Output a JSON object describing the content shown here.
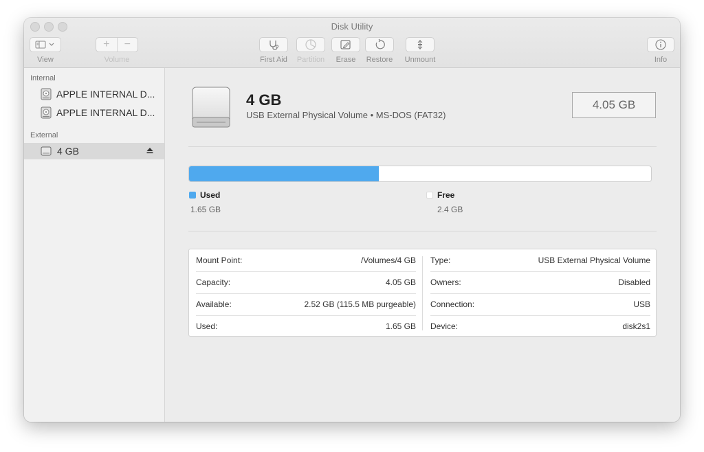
{
  "window": {
    "title": "Disk Utility"
  },
  "toolbar": {
    "view_label": "View",
    "volume_label": "Volume",
    "first_aid_label": "First Aid",
    "partition_label": "Partition",
    "erase_label": "Erase",
    "restore_label": "Restore",
    "unmount_label": "Unmount",
    "info_label": "Info"
  },
  "sidebar": {
    "internal_header": "Internal",
    "external_header": "External",
    "internal_items": [
      {
        "label": "APPLE INTERNAL D..."
      },
      {
        "label": "APPLE INTERNAL D..."
      }
    ],
    "external_items": [
      {
        "label": "4 GB",
        "selected": true
      }
    ]
  },
  "volume": {
    "name": "4 GB",
    "subtitle": "USB External Physical Volume • MS-DOS (FAT32)",
    "size": "4.05 GB"
  },
  "usage": {
    "used_fraction": 0.41,
    "used_label": "Used",
    "used_value": "1.65 GB",
    "used_color": "#4fa9ee",
    "free_label": "Free",
    "free_value": "2.4 GB",
    "free_color": "#ffffff"
  },
  "info": {
    "left": [
      {
        "key": "Mount Point:",
        "value": "/Volumes/4 GB"
      },
      {
        "key": "Capacity:",
        "value": "4.05 GB"
      },
      {
        "key": "Available:",
        "value": "2.52 GB (115.5 MB purgeable)"
      },
      {
        "key": "Used:",
        "value": "1.65 GB"
      }
    ],
    "right": [
      {
        "key": "Type:",
        "value": "USB External Physical Volume"
      },
      {
        "key": "Owners:",
        "value": "Disabled"
      },
      {
        "key": "Connection:",
        "value": "USB"
      },
      {
        "key": "Device:",
        "value": "disk2s1"
      }
    ]
  }
}
